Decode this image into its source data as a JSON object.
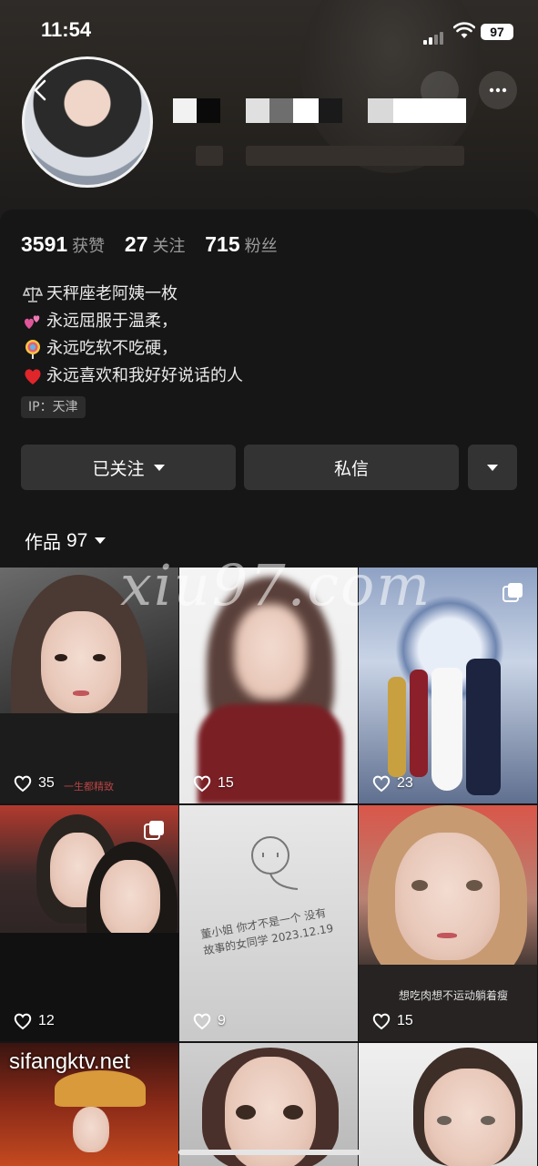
{
  "status_bar": {
    "time": "11:54",
    "battery": "97"
  },
  "profile": {
    "stats": [
      {
        "value": "3591",
        "label": "获赞"
      },
      {
        "value": "27",
        "label": "关注"
      },
      {
        "value": "715",
        "label": "粉丝"
      }
    ],
    "bio": [
      {
        "icon": "scales-icon",
        "text": "天秤座老阿姨一枚"
      },
      {
        "icon": "hearts-icon",
        "text": "永远屈服于温柔，"
      },
      {
        "icon": "lollipop-icon",
        "text": "永远吃软不吃硬，"
      },
      {
        "icon": "heart-icon",
        "text": "永远喜欢和我好好说话的人"
      }
    ],
    "ip": "IP：天津"
  },
  "actions": {
    "follow": "已关注",
    "message": "私信"
  },
  "works": {
    "label": "作品",
    "count": "97"
  },
  "grid": [
    {
      "likes": "35",
      "multi": false,
      "caption": "一生都精致"
    },
    {
      "likes": "15",
      "multi": false,
      "caption": ""
    },
    {
      "likes": "23",
      "multi": true,
      "caption": ""
    },
    {
      "likes": "12",
      "multi": true,
      "caption": ""
    },
    {
      "likes": "9",
      "multi": false,
      "caption": "董小姐 你才不是一个 没有故事的女同学 2023.12.19"
    },
    {
      "likes": "15",
      "multi": false,
      "caption": "想吃肉想不运动躺着瘦"
    }
  ],
  "watermarks": {
    "main": "xiu97.com",
    "corner": "sifangktv.net"
  },
  "colors": {
    "background": "#161616",
    "button": "#333333",
    "muted": "#9a9a9a"
  }
}
